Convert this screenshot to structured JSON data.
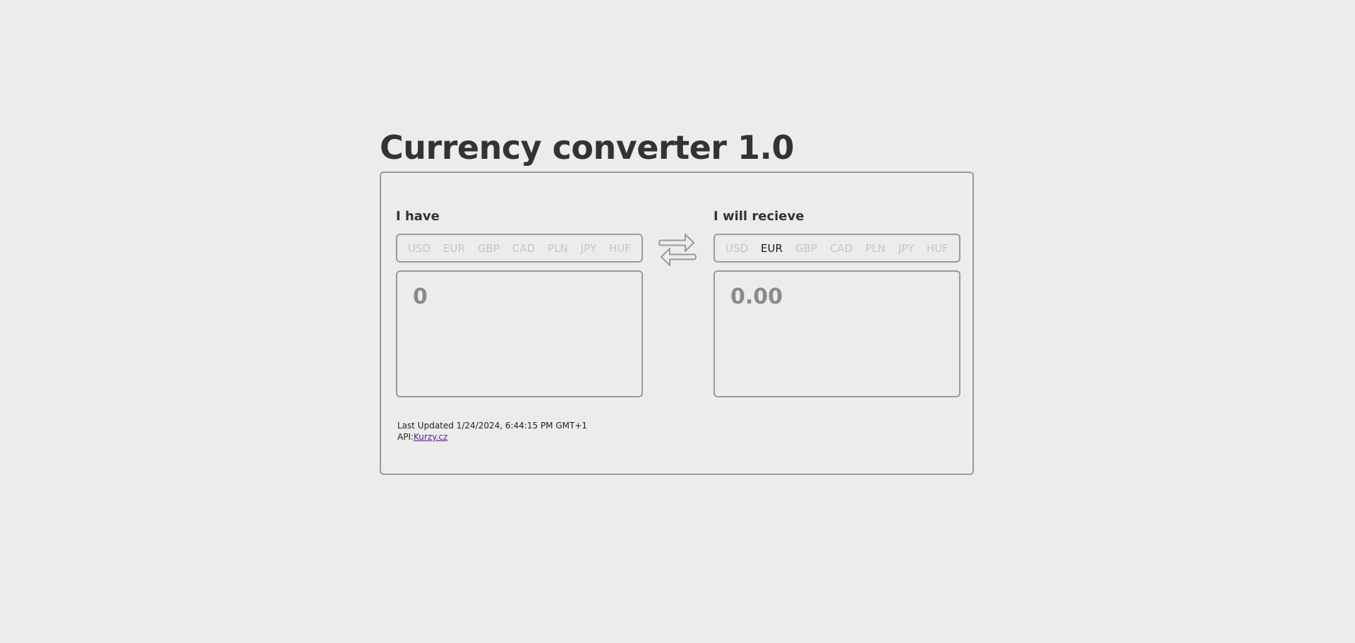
{
  "app": {
    "title": "Currency converter 1.0"
  },
  "from_panel": {
    "label": "I have",
    "currencies": [
      "USD",
      "EUR",
      "GBP",
      "CAD",
      "PLN",
      "JPY",
      "HUF"
    ],
    "selected": "",
    "amount_placeholder": "0",
    "amount_value": ""
  },
  "to_panel": {
    "label": "I will recieve",
    "currencies": [
      "USD",
      "EUR",
      "GBP",
      "CAD",
      "PLN",
      "JPY",
      "HUF"
    ],
    "selected": "EUR",
    "amount_placeholder": "0.00",
    "amount_value": ""
  },
  "swap": {
    "icon": "swap-arrows-icon"
  },
  "footer": {
    "last_updated": "Last Updated 1/24/2024, 6:44:15 PM GMT+1",
    "api_prefix": "API:",
    "api_link_text": "Kurzy.cz"
  },
  "colors": {
    "background": "#ececec",
    "border": "#9a9a9a",
    "title": "#333333",
    "currency_inactive": "#c6c6c6",
    "currency_active": "#1a1a1a",
    "amount_text": "#8a8a8a",
    "link": "#551a8b"
  }
}
